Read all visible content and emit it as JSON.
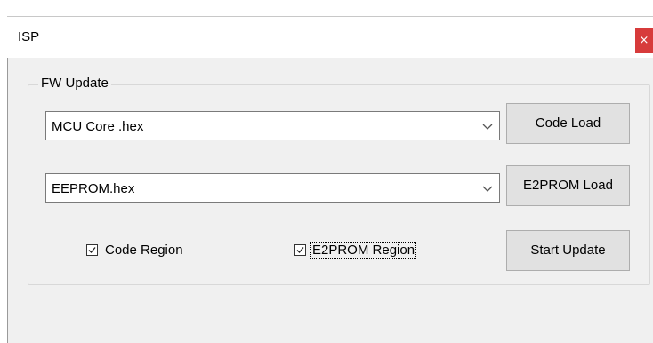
{
  "window": {
    "title": "ISP",
    "close_glyph": "×"
  },
  "group": {
    "legend": "FW Update"
  },
  "code_combo": {
    "value": "MCU Core .hex",
    "arrow_icon": "chevron-down-icon"
  },
  "eeprom_combo": {
    "value": "EEPROM.hex",
    "arrow_icon": "chevron-down-icon"
  },
  "buttons": {
    "code_load": "Code Load",
    "e2prom_load": "E2PROM Load",
    "start_update": "Start Update"
  },
  "checkboxes": {
    "code_region": {
      "label": "Code Region",
      "checked": true
    },
    "e2prom_region": {
      "label": "E2PROM Region",
      "checked": true,
      "focused": true
    }
  },
  "colors": {
    "close_button": "#d73b3b",
    "client_background": "#f0f0f0",
    "button_face": "#e1e1e1"
  }
}
